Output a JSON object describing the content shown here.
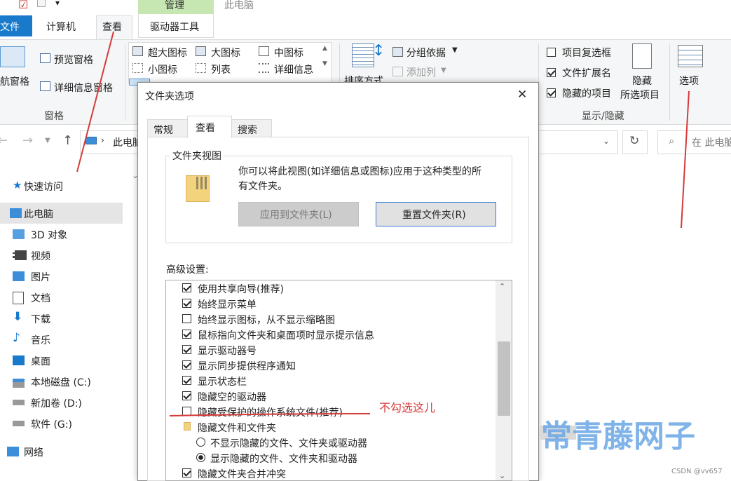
{
  "qat": {
    "checkbox": "☑",
    "folder": "📄",
    "dropdown": "▾"
  },
  "ribbon_tabs": [
    "文件",
    "计算机",
    "查看",
    "驱动器工具"
  ],
  "context_tab": "管理",
  "window_title": "此电脑",
  "ribbon": {
    "nav_pane": "导航窗格",
    "preview_pane": "预览窗格",
    "details_pane": "详细信息窗格",
    "pane_group": "窗格",
    "layouts": [
      "超大图标",
      "大图标",
      "中图标",
      "小图标",
      "列表",
      "详细信息"
    ],
    "sort_by": "排序方式",
    "group_by": "分组依据",
    "add_column": "添加列",
    "item_checkboxes": "项目复选框",
    "file_ext": "文件扩展名",
    "hidden_items": "隐藏的项目",
    "hide_selected_1": "隐藏",
    "hide_selected_2": "所选项目",
    "show_hide_group": "显示/隐藏",
    "options": "选项"
  },
  "address": {
    "path": "此电脑",
    "search_placeholder": "在 此电脑"
  },
  "nav": [
    {
      "label": "快速访问",
      "icon": "star-icon"
    },
    {
      "label": "此电脑",
      "icon": "computer-icon"
    },
    {
      "label": "3D 对象",
      "icon": "cube-icon"
    },
    {
      "label": "视频",
      "icon": "video-icon"
    },
    {
      "label": "图片",
      "icon": "picture-icon"
    },
    {
      "label": "文档",
      "icon": "document-icon"
    },
    {
      "label": "下载",
      "icon": "download-icon"
    },
    {
      "label": "音乐",
      "icon": "music-icon"
    },
    {
      "label": "桌面",
      "icon": "desktop-icon"
    },
    {
      "label": "本地磁盘 (C:)",
      "icon": "drive-icon"
    },
    {
      "label": "新加卷 (D:)",
      "icon": "drive-icon"
    },
    {
      "label": "软件 (G:)",
      "icon": "drive-icon"
    },
    {
      "label": "网络",
      "icon": "network-icon"
    }
  ],
  "dialog": {
    "title": "文件夹选项",
    "close": "✕",
    "tabs": [
      "常规",
      "查看",
      "搜索"
    ],
    "folder_views_title": "文件夹视图",
    "folder_views_desc_1": "你可以将此视图(如详细信息或图标)应用于这种类型的所",
    "folder_views_desc_2": "有文件夹。",
    "apply_btn": "应用到文件夹(L)",
    "reset_btn": "重置文件夹(R)",
    "advanced_title": "高级设置:",
    "advanced": [
      {
        "label": "使用共享向导(推荐)",
        "checked": true
      },
      {
        "label": "始终显示菜单",
        "checked": true
      },
      {
        "label": "始终显示图标，从不显示缩略图",
        "checked": false
      },
      {
        "label": "鼠标指向文件夹和桌面项时显示提示信息",
        "checked": true
      },
      {
        "label": "显示驱动器号",
        "checked": true
      },
      {
        "label": "显示同步提供程序通知",
        "checked": true
      },
      {
        "label": "显示状态栏",
        "checked": true
      },
      {
        "label": "隐藏空的驱动器",
        "checked": true
      },
      {
        "label": "隐藏受保护的操作系统文件(推荐)",
        "checked": false
      }
    ],
    "hidden_group": "隐藏文件和文件夹",
    "radio_1": "不显示隐藏的文件、文件夹或驱动器",
    "radio_2": "显示隐藏的文件、文件夹和驱动器",
    "last_item": "隐藏文件夹合并冲突"
  },
  "annotation": "不勾选这儿",
  "watermark": "常青藤网子",
  "credit": "CSDN @vv657"
}
